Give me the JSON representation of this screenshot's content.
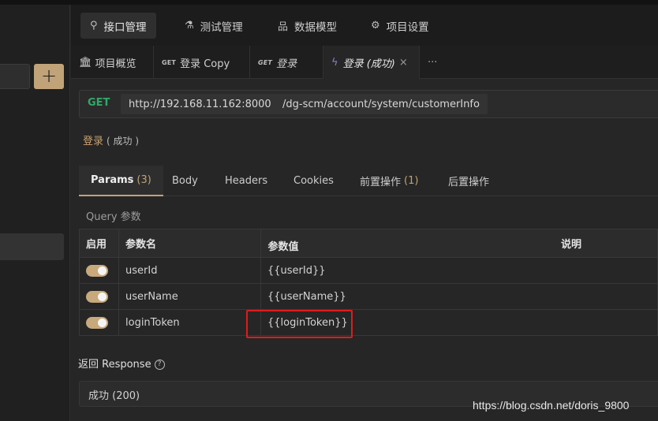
{
  "nav": {
    "items": [
      {
        "label": "接口管理",
        "icon": "api-link-icon"
      },
      {
        "label": "测试管理",
        "icon": "flask-icon"
      },
      {
        "label": "数据模型",
        "icon": "model-tree-icon"
      },
      {
        "label": "项目设置",
        "icon": "gear-icon"
      }
    ],
    "active": "接口管理"
  },
  "sidebar": {
    "add_label": "+"
  },
  "tabs": {
    "overview": "项目概览",
    "tab1_method": "GET",
    "tab1_label": "登录 Copy",
    "tab2_method": "GET",
    "tab2_label": "登录",
    "tab3_label": "登录 (成功)",
    "close": "×",
    "more": "···"
  },
  "request": {
    "method": "GET",
    "host": "http://192.168.11.162:8000",
    "path": "/dg-scm/account/system/customerInfo"
  },
  "api": {
    "name": "登录",
    "status": "( 成功 )"
  },
  "subtabs": {
    "params": "Params",
    "params_count": "(3)",
    "body": "Body",
    "headers": "Headers",
    "cookies": "Cookies",
    "pre": "前置操作",
    "pre_count": "(1)",
    "post": "后置操作"
  },
  "query_label": "Query 参数",
  "table": {
    "headers": {
      "enabled": "启用",
      "name": "参数名",
      "value": "参数值",
      "desc": "说明"
    },
    "rows": [
      {
        "name": "userId",
        "value": "{{userId}}",
        "desc": ""
      },
      {
        "name": "userName",
        "value": "{{userName}}",
        "desc": ""
      },
      {
        "name": "loginToken",
        "value": "{{loginToken}}",
        "desc": ""
      }
    ]
  },
  "response": {
    "label": "返回 Response",
    "help": "?",
    "status": "成功 (200)"
  },
  "watermark": "https://blog.csdn.net/doris_9800",
  "colors": {
    "accent": "#c0a378",
    "get": "#2fa86a",
    "highlight": "#e01b1b"
  }
}
